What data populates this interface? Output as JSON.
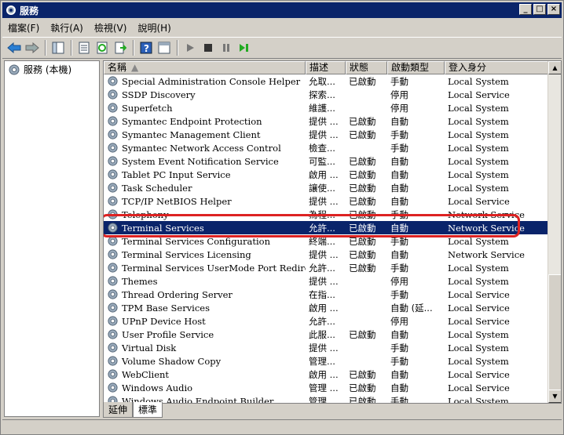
{
  "window": {
    "title": "服務"
  },
  "menu": [
    "檔案(F)",
    "執行(A)",
    "檢視(V)",
    "說明(H)"
  ],
  "toolbar_icons": [
    "back-icon",
    "forward-icon",
    "show-hide-tree-icon",
    "properties-icon",
    "refresh-icon",
    "export-icon",
    "help-icon",
    "view-icon",
    "start-icon",
    "stop-icon",
    "pause-icon",
    "restart-icon"
  ],
  "tree": {
    "root_label": "服務 (本機)"
  },
  "columns": {
    "name": "名稱",
    "desc": "描述",
    "status": "狀態",
    "startup": "啟動類型",
    "logon": "登入身分"
  },
  "services": [
    {
      "name": "Special Administration Console Helper",
      "desc": "允取...",
      "status": "已啟動",
      "startup": "手動",
      "logon": "Local System"
    },
    {
      "name": "SSDP Discovery",
      "desc": "探索...",
      "status": "",
      "startup": "停用",
      "logon": "Local Service"
    },
    {
      "name": "Superfetch",
      "desc": "維護...",
      "status": "",
      "startup": "停用",
      "logon": "Local System"
    },
    {
      "name": "Symantec Endpoint Protection",
      "desc": "提供 ...",
      "status": "已啟動",
      "startup": "自動",
      "logon": "Local System"
    },
    {
      "name": "Symantec Management Client",
      "desc": "提供 ...",
      "status": "已啟動",
      "startup": "手動",
      "logon": "Local System"
    },
    {
      "name": "Symantec Network Access Control",
      "desc": "檢查...",
      "status": "",
      "startup": "手動",
      "logon": "Local System"
    },
    {
      "name": "System Event Notification Service",
      "desc": "可監...",
      "status": "已啟動",
      "startup": "自動",
      "logon": "Local System"
    },
    {
      "name": "Tablet PC Input Service",
      "desc": "啟用 ...",
      "status": "已啟動",
      "startup": "自動",
      "logon": "Local System"
    },
    {
      "name": "Task Scheduler",
      "desc": "讓使...",
      "status": "已啟動",
      "startup": "自動",
      "logon": "Local System"
    },
    {
      "name": "TCP/IP NetBIOS Helper",
      "desc": "提供 ...",
      "status": "已啟動",
      "startup": "自動",
      "logon": "Local Service"
    },
    {
      "name": "Telephony",
      "desc": "為程...",
      "status": "已啟動",
      "startup": "手動",
      "logon": "Network Service"
    },
    {
      "name": "Terminal Services",
      "desc": "允許...",
      "status": "已啟動",
      "startup": "自動",
      "logon": "Network Service"
    },
    {
      "name": "Terminal Services Configuration",
      "desc": "終端...",
      "status": "已啟動",
      "startup": "手動",
      "logon": "Local System"
    },
    {
      "name": "Terminal Services Licensing",
      "desc": "提供 ...",
      "status": "已啟動",
      "startup": "自動",
      "logon": "Network Service"
    },
    {
      "name": "Terminal Services UserMode Port Redirector",
      "desc": "允許...",
      "status": "已啟動",
      "startup": "手動",
      "logon": "Local System"
    },
    {
      "name": "Themes",
      "desc": "提供 ...",
      "status": "",
      "startup": "停用",
      "logon": "Local System"
    },
    {
      "name": "Thread Ordering Server",
      "desc": "在指...",
      "status": "",
      "startup": "手動",
      "logon": "Local Service"
    },
    {
      "name": "TPM Base Services",
      "desc": "啟用 ...",
      "status": "",
      "startup": "自動 (延...",
      "logon": "Local Service"
    },
    {
      "name": "UPnP Device Host",
      "desc": "允許...",
      "status": "",
      "startup": "停用",
      "logon": "Local Service"
    },
    {
      "name": "User Profile Service",
      "desc": "此服...",
      "status": "已啟動",
      "startup": "自動",
      "logon": "Local System"
    },
    {
      "name": "Virtual Disk",
      "desc": "提供 ...",
      "status": "",
      "startup": "手動",
      "logon": "Local System"
    },
    {
      "name": "Volume Shadow Copy",
      "desc": "管理...",
      "status": "",
      "startup": "手動",
      "logon": "Local System"
    },
    {
      "name": "WebClient",
      "desc": "啟用 ...",
      "status": "已啟動",
      "startup": "自動",
      "logon": "Local Service"
    },
    {
      "name": "Windows Audio",
      "desc": "管理 ...",
      "status": "已啟動",
      "startup": "自動",
      "logon": "Local Service"
    },
    {
      "name": "Windows Audio Endpoint Builder",
      "desc": "管理 ...",
      "status": "已啟動",
      "startup": "手動",
      "logon": "Local System"
    }
  ],
  "selected_service": "Terminal Services",
  "tabs": {
    "extended": "延伸",
    "standard": "標準"
  },
  "colors": {
    "selection": "#0a246a",
    "highlight_box": "#dd2222",
    "titlebar": "#0a246a"
  }
}
